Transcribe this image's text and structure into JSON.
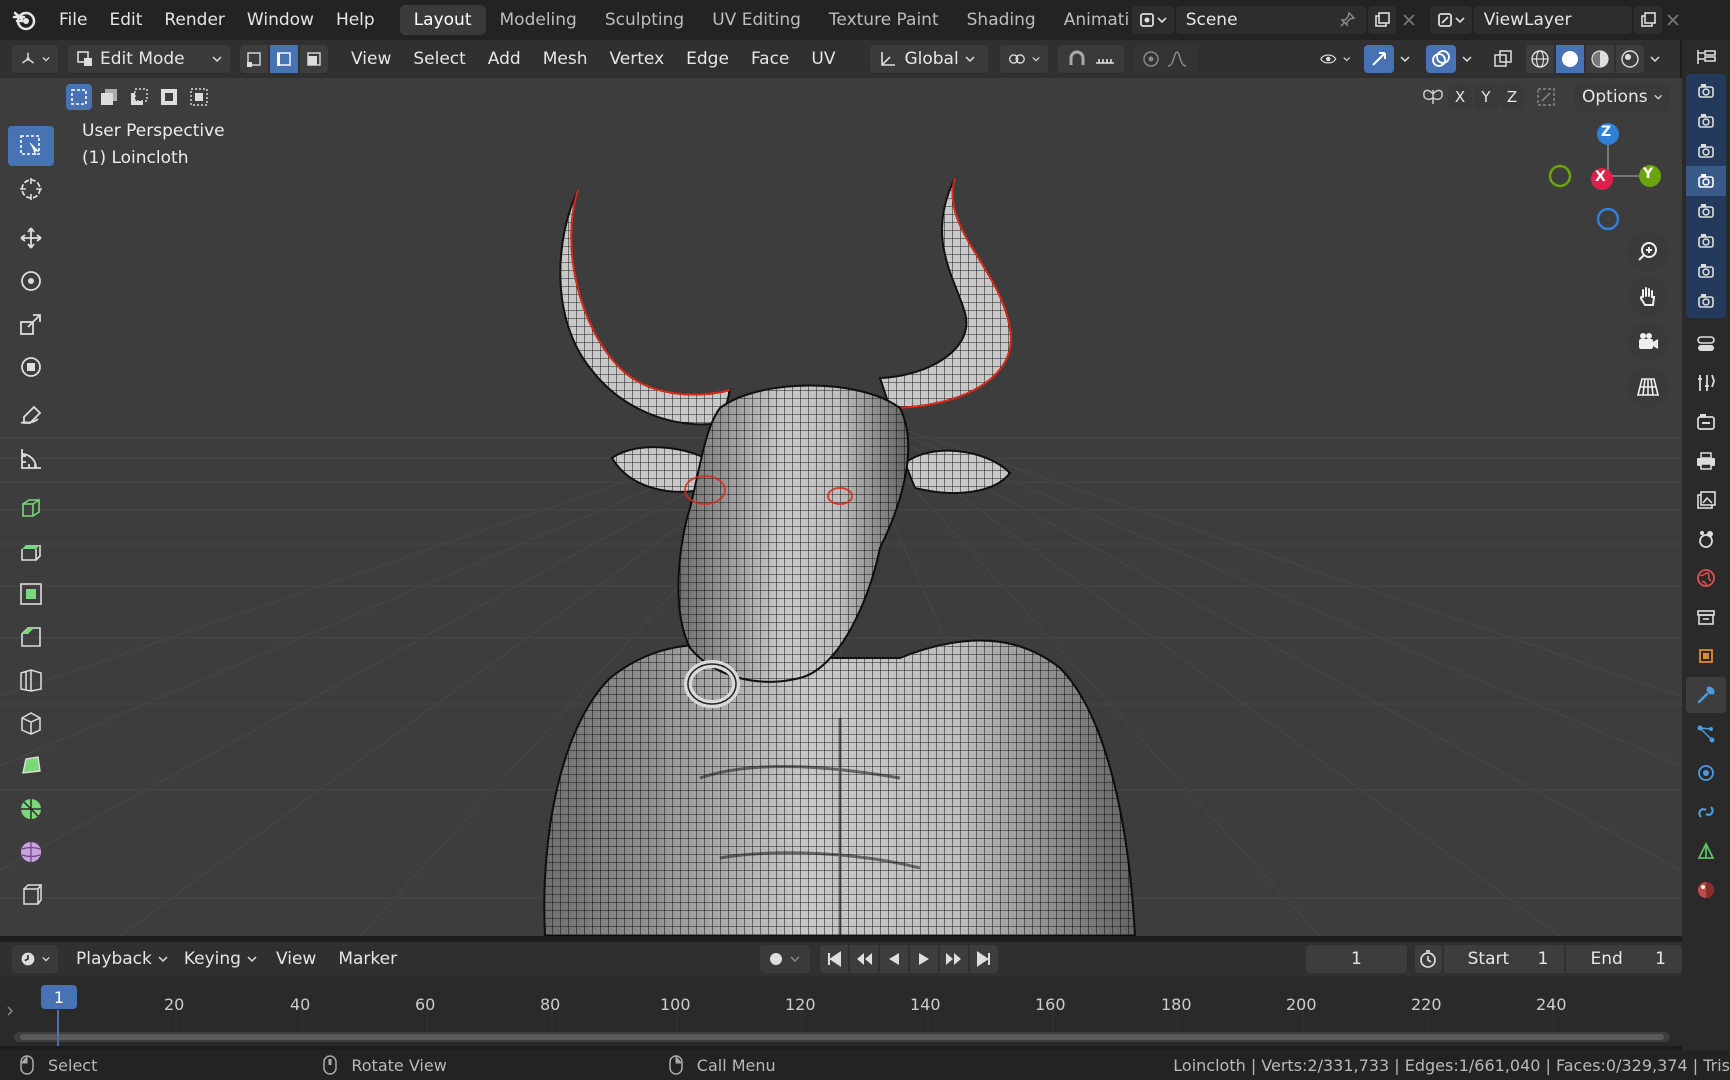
{
  "topbar": {
    "menus": [
      "File",
      "Edit",
      "Render",
      "Window",
      "Help"
    ],
    "workspaces": [
      "Layout",
      "Modeling",
      "Sculpting",
      "UV Editing",
      "Texture Paint",
      "Shading",
      "Animation"
    ],
    "active_workspace": "Layout",
    "scene": "Scene",
    "view_layer": "ViewLayer"
  },
  "header3d": {
    "mode": "Edit Mode",
    "menus": [
      "View",
      "Select",
      "Add",
      "Mesh",
      "Vertex",
      "Edge",
      "Face",
      "UV"
    ],
    "transform_orientation": "Global",
    "options": "Options",
    "axes": [
      "X",
      "Y",
      "Z"
    ]
  },
  "viewport": {
    "view_name": "User Perspective",
    "object_label": "(1) Loincloth",
    "gizmo": {
      "z": "Z",
      "y": "Y",
      "x": "X"
    }
  },
  "timeline": {
    "menus": [
      "Playback",
      "Keying",
      "View",
      "Marker"
    ],
    "current_frame": "1",
    "start_label": "Start",
    "start_value": "1",
    "end_label": "End",
    "end_value": "1",
    "ruler": [
      "1",
      "20",
      "40",
      "60",
      "80",
      "100",
      "120",
      "140",
      "160",
      "180",
      "200",
      "220",
      "240"
    ]
  },
  "statusbar": {
    "hints": [
      "Select",
      "Rotate View",
      "Call Menu"
    ],
    "stats": "Loincloth | Verts:2/331,733 | Edges:1/661,040 | Faces:0/329,374 | Tris"
  },
  "colors": {
    "active_blue": "#4772b3",
    "axis_x": "#e0204b",
    "axis_y": "#6ba50d",
    "axis_z": "#2f80d6",
    "selection_red": "#d92a1a"
  }
}
